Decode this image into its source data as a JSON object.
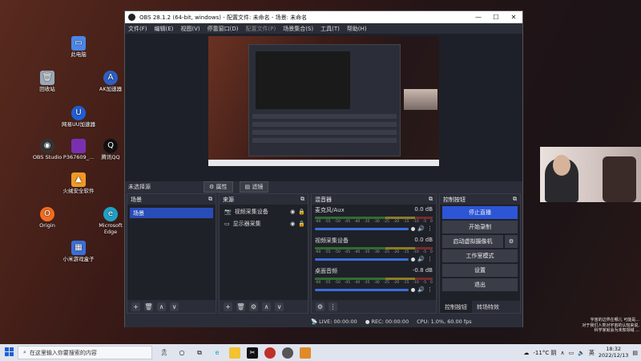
{
  "desktop": {
    "icons": [
      {
        "label": "此电脑",
        "icon": "computer-icon",
        "color": "#4a86e8"
      },
      {
        "label": "回收站",
        "icon": "recycle-bin-icon",
        "color": "#9aa8b8"
      },
      {
        "label": "AK加速器",
        "icon": "ak-accelerator-icon",
        "color": "#2d5fc4"
      },
      {
        "label": "网易UU加速器",
        "icon": "uu-accelerator-icon",
        "color": "#1f5fd6"
      },
      {
        "label": "OBS Studio",
        "icon": "obs-icon",
        "color": "#333333"
      },
      {
        "label": "P367609_...",
        "icon": "image-file-icon",
        "color": "#7a2fb0"
      },
      {
        "label": "腾讯QQ",
        "icon": "qq-icon",
        "color": "#111111"
      },
      {
        "label": "火绒安全软件",
        "icon": "huorong-icon",
        "color": "#f09a24"
      },
      {
        "label": "Origin",
        "icon": "origin-icon",
        "color": "#f26d21"
      },
      {
        "label": "Microsoft Edge",
        "icon": "edge-icon",
        "color": "#1fa0c7"
      },
      {
        "label": "小米游戏盒子",
        "icon": "xiaomi-game-icon",
        "color": "#3a6fd9"
      }
    ]
  },
  "obs": {
    "title": "OBS 28.1.2 (64-bit, windows) - 配置文件: 未命名 - 场景: 未命名",
    "menu": [
      "文件(F)",
      "编辑(E)",
      "视图(V)",
      "停靠窗口(D)",
      "配置文件(P)",
      "场景集合(S)",
      "工具(T)",
      "帮助(H)"
    ],
    "no_source": "未选择源",
    "properties": "属性",
    "filters": "滤镜",
    "scenes_dock": {
      "title": "场景",
      "items": [
        "场景"
      ]
    },
    "sources_dock": {
      "title": "来源",
      "items": [
        "视频采集设备",
        "显示器采集"
      ]
    },
    "mixer_dock": {
      "title": "混音器",
      "scale": [
        "-60",
        "-55",
        "-50",
        "-45",
        "-40",
        "-35",
        "-30",
        "-25",
        "-20",
        "-15",
        "-10",
        "-5",
        "0"
      ],
      "channels": [
        {
          "name": "麦克风/Aux",
          "db": "0.0 dB"
        },
        {
          "name": "视频采集设备",
          "db": "0.0 dB"
        },
        {
          "name": "桌面音频",
          "db": "-0.8 dB"
        }
      ]
    },
    "controls_dock": {
      "title": "控制按钮",
      "buttons": [
        "停止直播",
        "开始录制",
        "启动虚拟摄像机",
        "工作室模式",
        "设置",
        "退出"
      ],
      "tabs": [
        "控制按钮",
        "转场特效"
      ]
    },
    "status": {
      "live": "LIVE: 00:00:00",
      "rec": "REC: 00:00:00",
      "cpu": "CPU: 1.0%, 60.00 fps"
    }
  },
  "notice": {
    "line1": "宇宙的边界在哪儿 可能是...",
    "line2": "对于我们人类对宇宙的认知来说,",
    "line3": "科学家就会为未知领域 ..."
  },
  "taskbar": {
    "search_placeholder": "在这里输入你要搜索的内容",
    "weather": "-11°C 阴",
    "ime": "英",
    "time": "18:32",
    "date": "2022/12/13"
  }
}
